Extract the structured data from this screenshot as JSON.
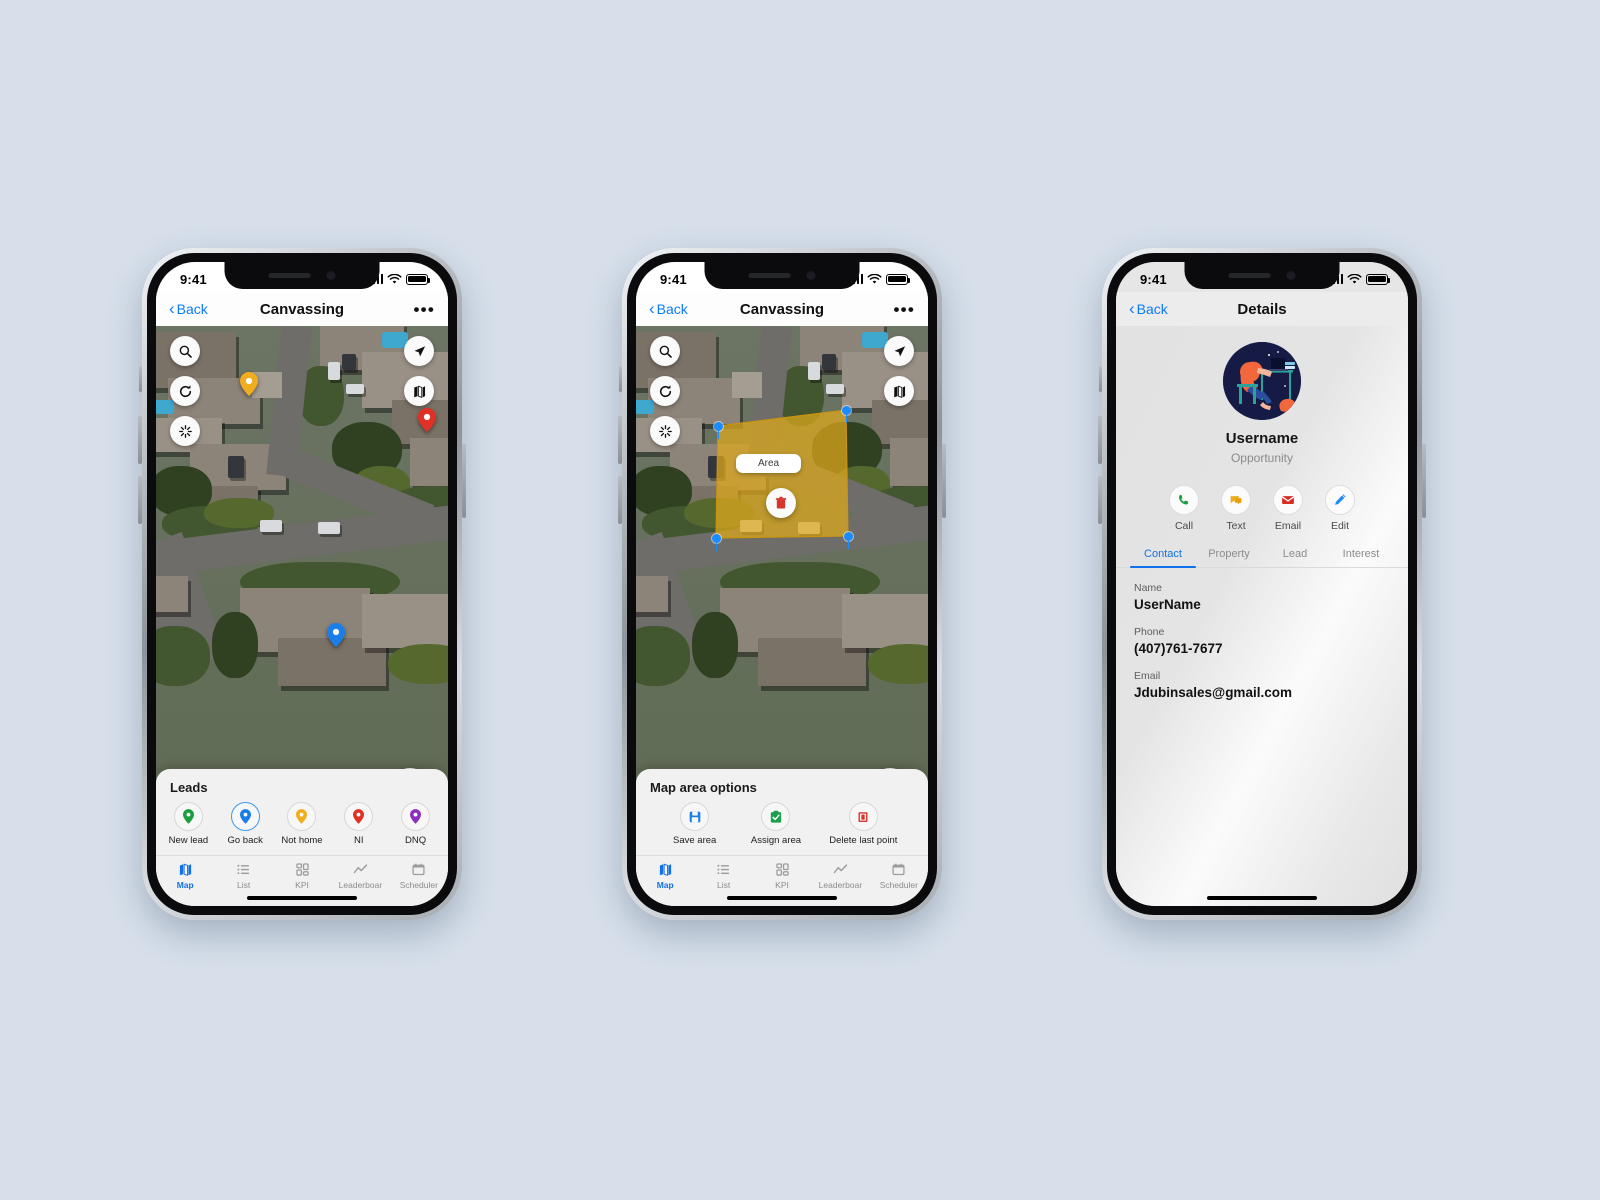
{
  "background_color": "#d6dfea",
  "accent_color": "#0a7bff",
  "phones": [
    {
      "id": "canvassing-leads",
      "status": {
        "time": "9:41"
      },
      "nav": {
        "back": "Back",
        "title": "Canvassing",
        "more": "•••"
      },
      "map_controls": [
        {
          "name": "search-icon"
        },
        {
          "name": "refresh-icon"
        },
        {
          "name": "loading-spinner-icon"
        },
        {
          "name": "navigate-icon"
        },
        {
          "name": "map-layers-icon"
        }
      ],
      "map_pins": [
        {
          "name": "pin-not-home",
          "color": "#f0ad1e"
        },
        {
          "name": "pin-ni",
          "color": "#e03127"
        },
        {
          "name": "pin-go-back",
          "color": "#1a7ee8"
        }
      ],
      "fab": {
        "name": "current-location-fab",
        "color": "#1a7ee8"
      },
      "sheet": {
        "title": "Leads",
        "items": [
          {
            "label": "New lead",
            "color": "#1a9e3e",
            "selected": false
          },
          {
            "label": "Go back",
            "color": "#1a7ee8",
            "selected": true
          },
          {
            "label": "Not home",
            "color": "#f0ad1e",
            "selected": false
          },
          {
            "label": "NI",
            "color": "#e03127",
            "selected": false
          },
          {
            "label": "DNQ",
            "color": "#8e2fbf",
            "selected": false
          }
        ]
      },
      "tabs": [
        {
          "label": "Map",
          "icon": "map-icon",
          "active": true
        },
        {
          "label": "List",
          "icon": "list-icon",
          "active": false
        },
        {
          "label": "KPI",
          "icon": "grid-icon",
          "active": false
        },
        {
          "label": "Leaderboar",
          "icon": "trending-up-icon",
          "active": false
        },
        {
          "label": "Scheduler",
          "icon": "calendar-icon",
          "active": false
        }
      ]
    },
    {
      "id": "canvassing-area",
      "status": {
        "time": "9:41"
      },
      "nav": {
        "back": "Back",
        "title": "Canvassing",
        "more": "•••"
      },
      "map_controls": [
        {
          "name": "search-icon"
        },
        {
          "name": "refresh-icon"
        },
        {
          "name": "loading-spinner-icon"
        },
        {
          "name": "navigate-icon"
        },
        {
          "name": "map-layers-icon"
        }
      ],
      "area": {
        "chip_label": "Area",
        "fill_color": "#e0a91b",
        "vertex_color": "#1a8cff",
        "vertex_count": 4,
        "delete_icon": "trash-icon"
      },
      "close_fab": {
        "name": "close-fab",
        "color": "#d03128"
      },
      "sheet": {
        "title": "Map area options",
        "items": [
          {
            "label": "Save area",
            "icon": "save-icon",
            "color": "#1b7ee8"
          },
          {
            "label": "Assign area",
            "icon": "assign-check-icon",
            "color": "#1ba04b"
          },
          {
            "label": "Delete last point",
            "icon": "delete-icon",
            "color": "#e03127"
          }
        ]
      },
      "tabs": [
        {
          "label": "Map",
          "icon": "map-icon",
          "active": true
        },
        {
          "label": "List",
          "icon": "list-icon",
          "active": false
        },
        {
          "label": "KPI",
          "icon": "grid-icon",
          "active": false
        },
        {
          "label": "Leaderboar",
          "icon": "trending-up-icon",
          "active": false
        },
        {
          "label": "Scheduler",
          "icon": "calendar-icon",
          "active": false
        }
      ]
    },
    {
      "id": "details",
      "status": {
        "time": "9:41"
      },
      "nav": {
        "back": "Back",
        "title": "Details"
      },
      "profile": {
        "name": "Username",
        "subtitle": "Opportunity",
        "avatar": "person-at-desk-illustration"
      },
      "actions": [
        {
          "label": "Call",
          "icon": "phone-icon",
          "color": "#1a9e3e"
        },
        {
          "label": "Text",
          "icon": "chat-icon",
          "color": "#edad1c"
        },
        {
          "label": "Email",
          "icon": "envelope-icon",
          "color": "#d82c22"
        },
        {
          "label": "Edit",
          "icon": "pencil-icon",
          "color": "#1a8cff"
        }
      ],
      "tabs": [
        {
          "label": "Contact",
          "active": true
        },
        {
          "label": "Property",
          "active": false
        },
        {
          "label": "Lead",
          "active": false
        },
        {
          "label": "Interest",
          "active": false
        }
      ],
      "fields": [
        {
          "label": "Name",
          "value": "UserName"
        },
        {
          "label": "Phone",
          "value": "(407)761-7677"
        },
        {
          "label": "Email",
          "value": "Jdubinsales@gmail.com"
        }
      ]
    }
  ]
}
